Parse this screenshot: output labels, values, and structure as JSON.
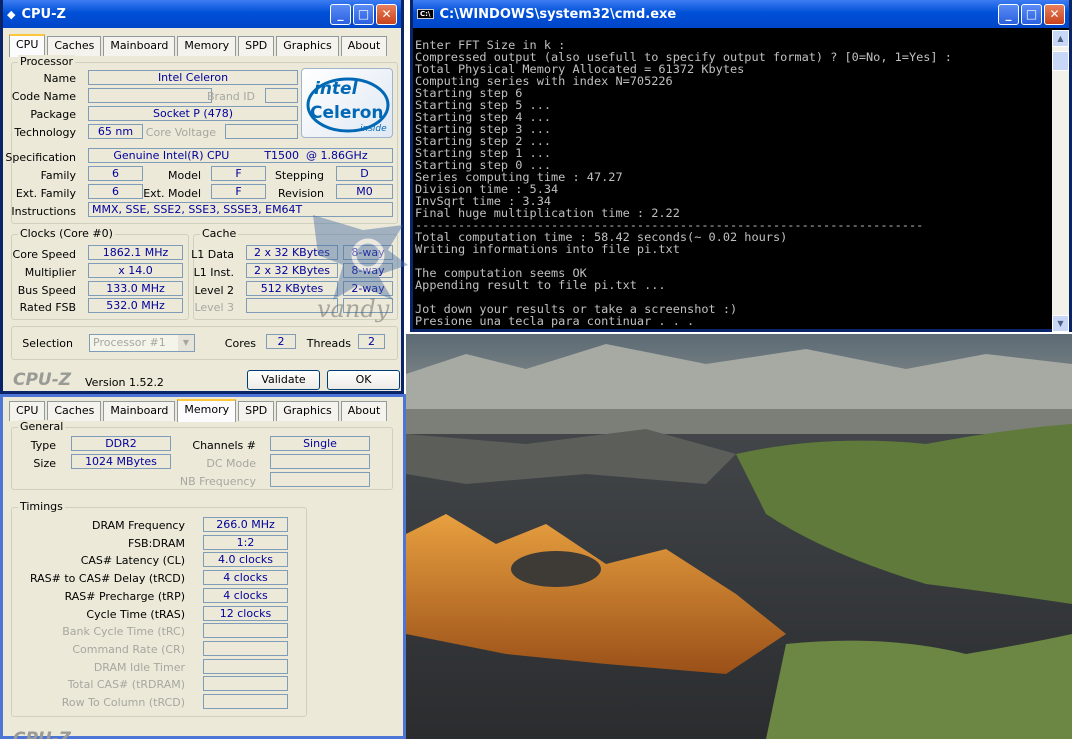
{
  "cpuz_top": {
    "title": "CPU-Z",
    "tabs": [
      "CPU",
      "Caches",
      "Mainboard",
      "Memory",
      "SPD",
      "Graphics",
      "About"
    ],
    "processor": {
      "group": "Processor",
      "name_label": "Name",
      "name": "Intel Celeron",
      "codename_label": "Code Name",
      "brandid_label": "Brand ID",
      "package_label": "Package",
      "package": "Socket P (478)",
      "technology_label": "Technology",
      "technology": "65 nm",
      "corevoltage_label": "Core Voltage",
      "spec_label": "Specification",
      "spec": "Genuine Intel(R) CPU          T1500  @ 1.86GHz",
      "family_label": "Family",
      "family": "6",
      "model_label": "Model",
      "model": "F",
      "stepping_label": "Stepping",
      "stepping": "D",
      "extfamily_label": "Ext. Family",
      "extfamily": "6",
      "extmodel_label": "Ext. Model",
      "extmodel": "F",
      "revision_label": "Revision",
      "revision": "M0",
      "instructions_label": "Instructions",
      "instructions": "MMX, SSE, SSE2, SSE3, SSSE3, EM64T"
    },
    "logo": {
      "brand": "intel",
      "product": "Celeron",
      "tag": "inside"
    },
    "clocks": {
      "group": "Clocks (Core #0)",
      "corespeed_label": "Core Speed",
      "corespeed": "1862.1 MHz",
      "multiplier_label": "Multiplier",
      "multiplier": "x 14.0",
      "busspeed_label": "Bus Speed",
      "busspeed": "133.0 MHz",
      "ratedfsb_label": "Rated FSB",
      "ratedfsb": "532.0 MHz"
    },
    "cache": {
      "group": "Cache",
      "l1data_label": "L1 Data",
      "l1data": "2 x 32 KBytes",
      "l1data_way": "8-way",
      "l1inst_label": "L1 Inst.",
      "l1inst": "2 x 32 KBytes",
      "l1inst_way": "8-way",
      "level2_label": "Level 2",
      "level2": "512 KBytes",
      "level2_way": "2-way",
      "level3_label": "Level 3"
    },
    "selection_label": "Selection",
    "selection": "Processor #1",
    "cores_label": "Cores",
    "cores": "2",
    "threads_label": "Threads",
    "threads": "2",
    "footer_logo": "CPU-Z",
    "version": "Version 1.52.2",
    "validate": "Validate",
    "ok": "OK",
    "watermark": "vandy"
  },
  "cpuz_bottom": {
    "tabs": [
      "CPU",
      "Caches",
      "Mainboard",
      "Memory",
      "SPD",
      "Graphics",
      "About"
    ],
    "general": {
      "group": "General",
      "type_label": "Type",
      "type": "DDR2",
      "size_label": "Size",
      "size": "1024 MBytes",
      "channels_label": "Channels #",
      "channels": "Single",
      "dcmode_label": "DC Mode",
      "nbfreq_label": "NB Frequency"
    },
    "timings": {
      "group": "Timings",
      "rows": [
        {
          "label": "DRAM Frequency",
          "value": "266.0 MHz"
        },
        {
          "label": "FSB:DRAM",
          "value": "1:2"
        },
        {
          "label": "CAS# Latency (CL)",
          "value": "4.0 clocks"
        },
        {
          "label": "RAS# to CAS# Delay (tRCD)",
          "value": "4 clocks"
        },
        {
          "label": "RAS# Precharge (tRP)",
          "value": "4 clocks"
        },
        {
          "label": "Cycle Time (tRAS)",
          "value": "12 clocks"
        }
      ],
      "disabled": [
        "Bank Cycle Time (tRC)",
        "Command Rate (CR)",
        "DRAM Idle Timer",
        "Total CAS# (tRDRAM)",
        "Row To Column (tRCD)"
      ]
    },
    "footer_logo": "CPU-Z"
  },
  "cmd": {
    "title": "C:\\WINDOWS\\system32\\cmd.exe",
    "lines": [
      "Enter FFT Size in k :",
      "Compressed output (also usefull to specify output format) ? [0=No, 1=Yes] :",
      "Total Physical Memory Allocated = 61372 Kbytes",
      "Computing series with index N=705226",
      "Starting step 6",
      "Starting step 5 ...",
      "Starting step 4 ...",
      "Starting step 3 ...",
      "Starting step 2 ...",
      "Starting step 1 ...",
      "Starting step 0 ...",
      "Series computing time : 47.27",
      "Division time : 5.34",
      "InvSqrt time : 3.34",
      "Final huge multiplication time : 2.22",
      "-----------------------------------------------------------------------",
      "Total computation time : 58.42 seconds(~ 0.02 hours)",
      "Writing informations into file pi.txt",
      "",
      "The computation seems OK",
      "Appending result to file pi.txt ...",
      "",
      "Jot down your results or take a screenshot :)",
      "Presione una tecla para continuar . . ."
    ]
  }
}
